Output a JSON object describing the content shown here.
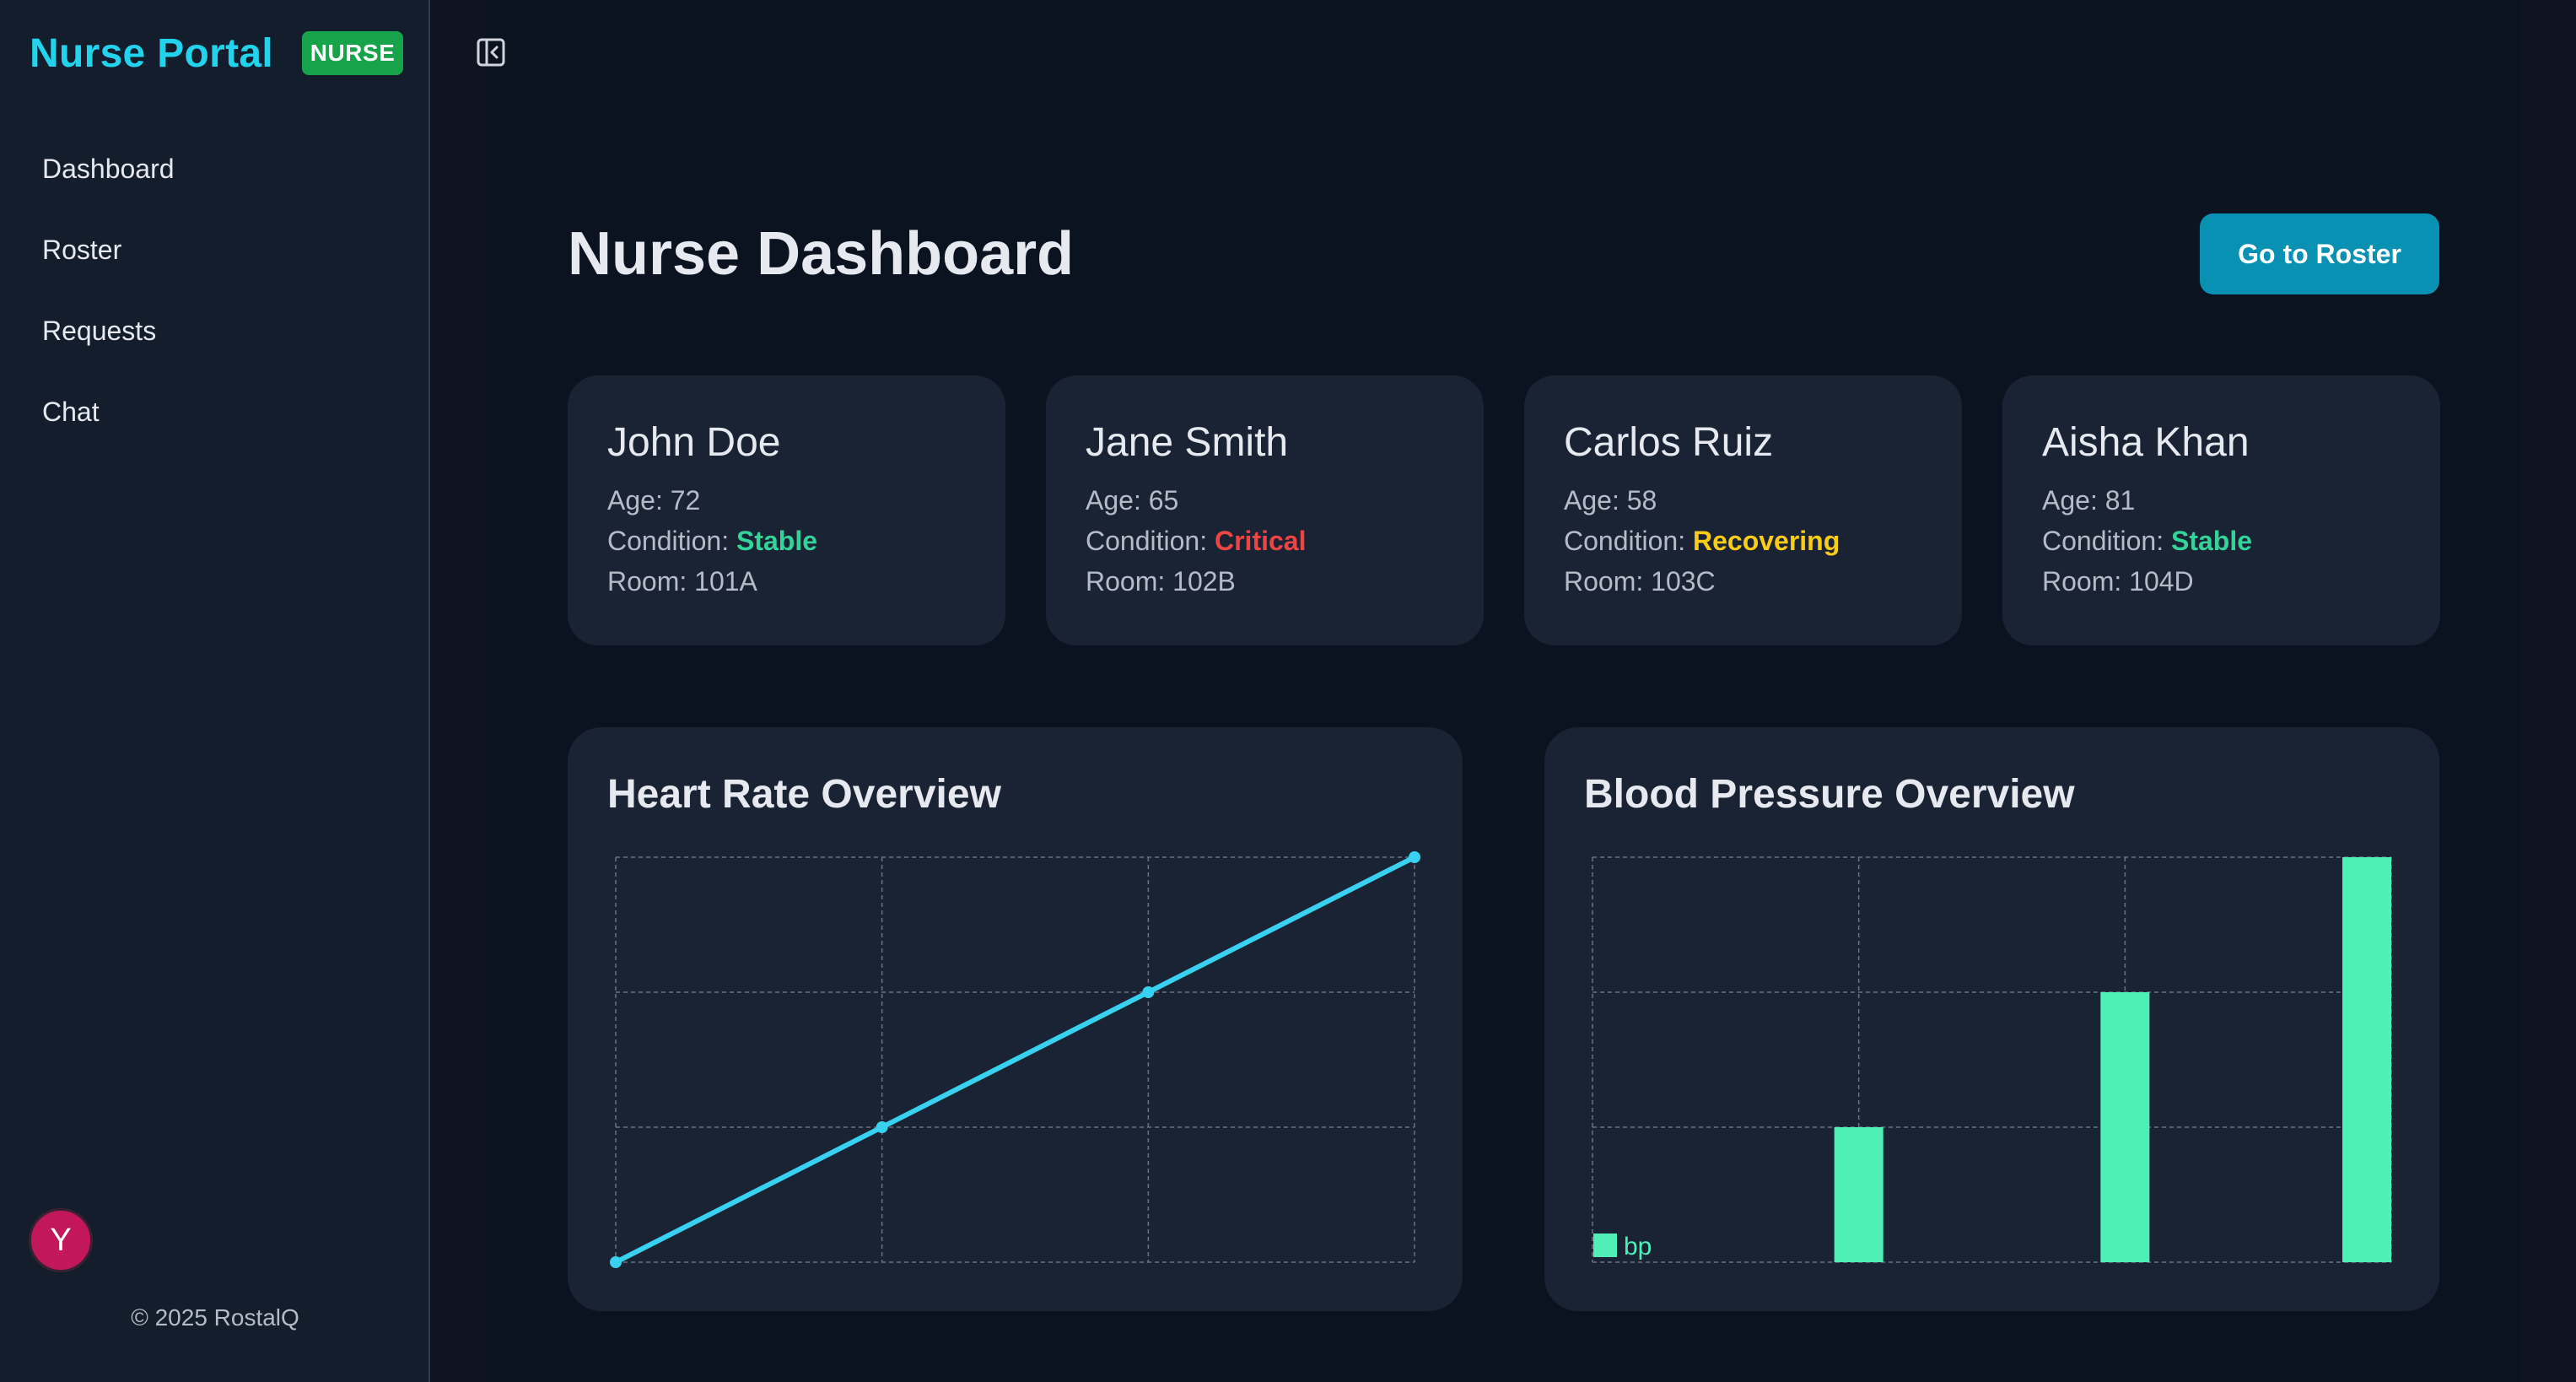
{
  "sidebar": {
    "brand": "Nurse Portal",
    "role_badge": "NURSE",
    "nav": [
      {
        "label": "Dashboard"
      },
      {
        "label": "Roster"
      },
      {
        "label": "Requests"
      },
      {
        "label": "Chat"
      }
    ],
    "avatar_initial": "Y",
    "copyright": "© 2025 RostalQ"
  },
  "header": {
    "title": "Nurse Dashboard",
    "roster_button": "Go to Roster"
  },
  "patients": [
    {
      "name": "John Doe",
      "age_label": "Age: 72",
      "condition_label": "Condition: ",
      "condition": "Stable",
      "condition_color": "#34d399",
      "room_label": "Room: 101A"
    },
    {
      "name": "Jane Smith",
      "age_label": "Age: 65",
      "condition_label": "Condition: ",
      "condition": "Critical",
      "condition_color": "#ef4444",
      "room_label": "Room: 102B"
    },
    {
      "name": "Carlos Ruiz",
      "age_label": "Age: 58",
      "condition_label": "Condition: ",
      "condition": "Recovering",
      "condition_color": "#facc15",
      "room_label": "Room: 103C"
    },
    {
      "name": "Aisha Khan",
      "age_label": "Age: 81",
      "condition_label": "Condition: ",
      "condition": "Stable",
      "condition_color": "#34d399",
      "room_label": "Room: 104D"
    }
  ],
  "charts": {
    "heart_title": "Heart Rate Overview",
    "bp_title": "Blood Pressure Overview"
  },
  "chart_data": [
    {
      "type": "line",
      "title": "Heart Rate Overview",
      "x": [
        0,
        1,
        2,
        3
      ],
      "series": [
        {
          "values": [
            0,
            1,
            2,
            3
          ],
          "color": "#38d2f0"
        }
      ],
      "ylim": [
        0,
        3
      ],
      "grid": true
    },
    {
      "type": "bar",
      "title": "Blood Pressure Overview",
      "categories": [
        "",
        "",
        "",
        ""
      ],
      "series": [
        {
          "name": "bp",
          "values": [
            0,
            1,
            2,
            3
          ],
          "color": "#4ff0b8"
        }
      ],
      "ylim": [
        0,
        3
      ],
      "grid": true,
      "legend": "bottom-left"
    }
  ]
}
